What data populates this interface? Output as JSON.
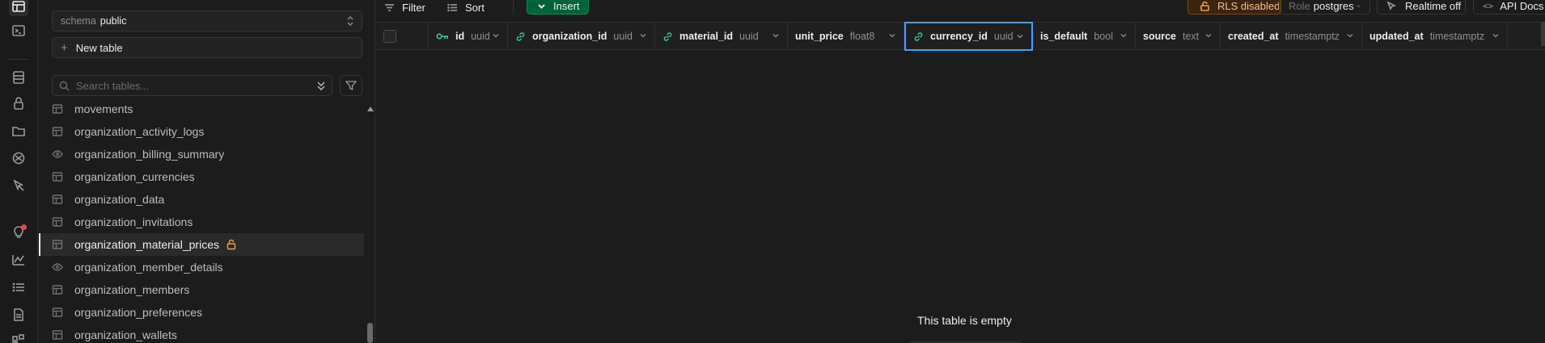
{
  "rail": {
    "icons": [
      "table-editor-icon",
      "sql-editor-icon",
      "database-icon",
      "auth-icon",
      "storage-icon",
      "edge-functions-icon",
      "realtime-icon",
      "advisors-icon",
      "reports-icon",
      "logs-icon",
      "api-docs-icon",
      "integrations-icon"
    ]
  },
  "sidebar": {
    "schema_label": "schema",
    "schema_value": "public",
    "new_table_label": "New table",
    "search_placeholder": "Search tables...",
    "tables": [
      {
        "name": "movements",
        "type": "table"
      },
      {
        "name": "organization_activity_logs",
        "type": "table"
      },
      {
        "name": "organization_billing_summary",
        "type": "view"
      },
      {
        "name": "organization_currencies",
        "type": "table"
      },
      {
        "name": "organization_data",
        "type": "table"
      },
      {
        "name": "organization_invitations",
        "type": "table"
      },
      {
        "name": "organization_material_prices",
        "type": "table",
        "active": true,
        "locked": true
      },
      {
        "name": "organization_member_details",
        "type": "view"
      },
      {
        "name": "organization_members",
        "type": "table"
      },
      {
        "name": "organization_preferences",
        "type": "table"
      },
      {
        "name": "organization_wallets",
        "type": "table"
      }
    ]
  },
  "toolbar": {
    "filter_label": "Filter",
    "sort_label": "Sort",
    "insert_label": "Insert",
    "rls_label": "RLS disabled",
    "role_label": "Role",
    "role_value": "postgres",
    "realtime_label": "Realtime off",
    "api_docs_label": "API Docs"
  },
  "grid": {
    "columns": [
      {
        "name": "id",
        "type": "uuid",
        "key": "primary"
      },
      {
        "name": "organization_id",
        "type": "uuid",
        "key": "foreign"
      },
      {
        "name": "material_id",
        "type": "uuid",
        "key": "foreign"
      },
      {
        "name": "unit_price",
        "type": "float8",
        "key": ""
      },
      {
        "name": "currency_id",
        "type": "uuid",
        "key": "foreign",
        "selected": true
      },
      {
        "name": "is_default",
        "type": "bool",
        "key": ""
      },
      {
        "name": "source",
        "type": "text",
        "key": ""
      },
      {
        "name": "created_at",
        "type": "timestamptz",
        "key": ""
      },
      {
        "name": "updated_at",
        "type": "timestamptz",
        "key": ""
      }
    ],
    "empty_message": "This table is empty"
  },
  "colors": {
    "accent_green": "#006239",
    "warning_orange": "#f5a04a",
    "selection_blue": "#4a9eff",
    "key_green": "#3ecf8e"
  }
}
